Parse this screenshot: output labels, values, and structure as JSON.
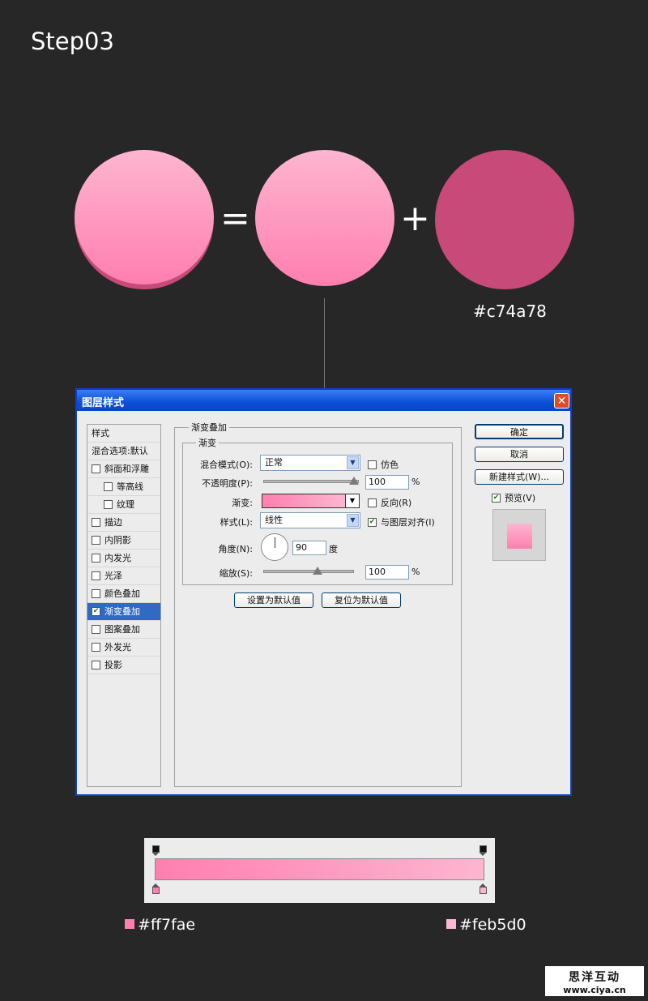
{
  "step_title": "Step03",
  "equation": {
    "equals": "=",
    "plus": "+",
    "base_color_hex": "#c74a78"
  },
  "colors": {
    "gradient_start": "#ff7fae",
    "gradient_end": "#feb5d0",
    "base": "#c74a78",
    "dialog_blue": "#0a4fd8"
  },
  "dialog": {
    "title": "图层样式",
    "close_icon": "close-icon",
    "sidebar": {
      "header": "样式",
      "blend_options": "混合选项:默认",
      "items": [
        {
          "label": "斜面和浮雕",
          "checked": false,
          "indent": false
        },
        {
          "label": "等高线",
          "checked": false,
          "indent": true
        },
        {
          "label": "纹理",
          "checked": false,
          "indent": true
        },
        {
          "label": "描边",
          "checked": false,
          "indent": false
        },
        {
          "label": "内阴影",
          "checked": false,
          "indent": false
        },
        {
          "label": "内发光",
          "checked": false,
          "indent": false
        },
        {
          "label": "光泽",
          "checked": false,
          "indent": false
        },
        {
          "label": "颜色叠加",
          "checked": false,
          "indent": false
        },
        {
          "label": "渐变叠加",
          "checked": true,
          "indent": false,
          "selected": true
        },
        {
          "label": "图案叠加",
          "checked": false,
          "indent": false
        },
        {
          "label": "外发光",
          "checked": false,
          "indent": false
        },
        {
          "label": "投影",
          "checked": false,
          "indent": false
        }
      ]
    },
    "section_title": "渐变叠加",
    "group_title": "渐变",
    "blend_mode": {
      "label": "混合模式(O):",
      "value": "正常"
    },
    "dither": {
      "label": "仿色",
      "checked": false
    },
    "opacity": {
      "label": "不透明度(P):",
      "value": "100",
      "unit": "%",
      "level": 1.0
    },
    "gradient": {
      "label": "渐变:"
    },
    "reverse": {
      "label": "反向(R)",
      "checked": false
    },
    "style": {
      "label": "样式(L):",
      "value": "线性"
    },
    "align_layer": {
      "label": "与图层对齐(I)",
      "checked": true
    },
    "angle": {
      "label": "角度(N):",
      "value": "90",
      "unit": "度"
    },
    "scale": {
      "label": "缩放(S):",
      "value": "100",
      "unit": "%",
      "level": 0.6
    },
    "set_default": "设置为默认值",
    "reset_default": "复位为默认值",
    "ok": "确定",
    "cancel": "取消",
    "new_style": "新建样式(W)...",
    "preview": {
      "label": "预览(V)",
      "checked": true
    }
  },
  "gradient_bar": {
    "left_color": "#ff7fae",
    "right_color": "#feb5d0",
    "left_label": "#ff7fae",
    "right_label": "#feb5d0"
  },
  "watermark": {
    "line1": "思洋互动",
    "line2": "www.ciya.cn"
  }
}
